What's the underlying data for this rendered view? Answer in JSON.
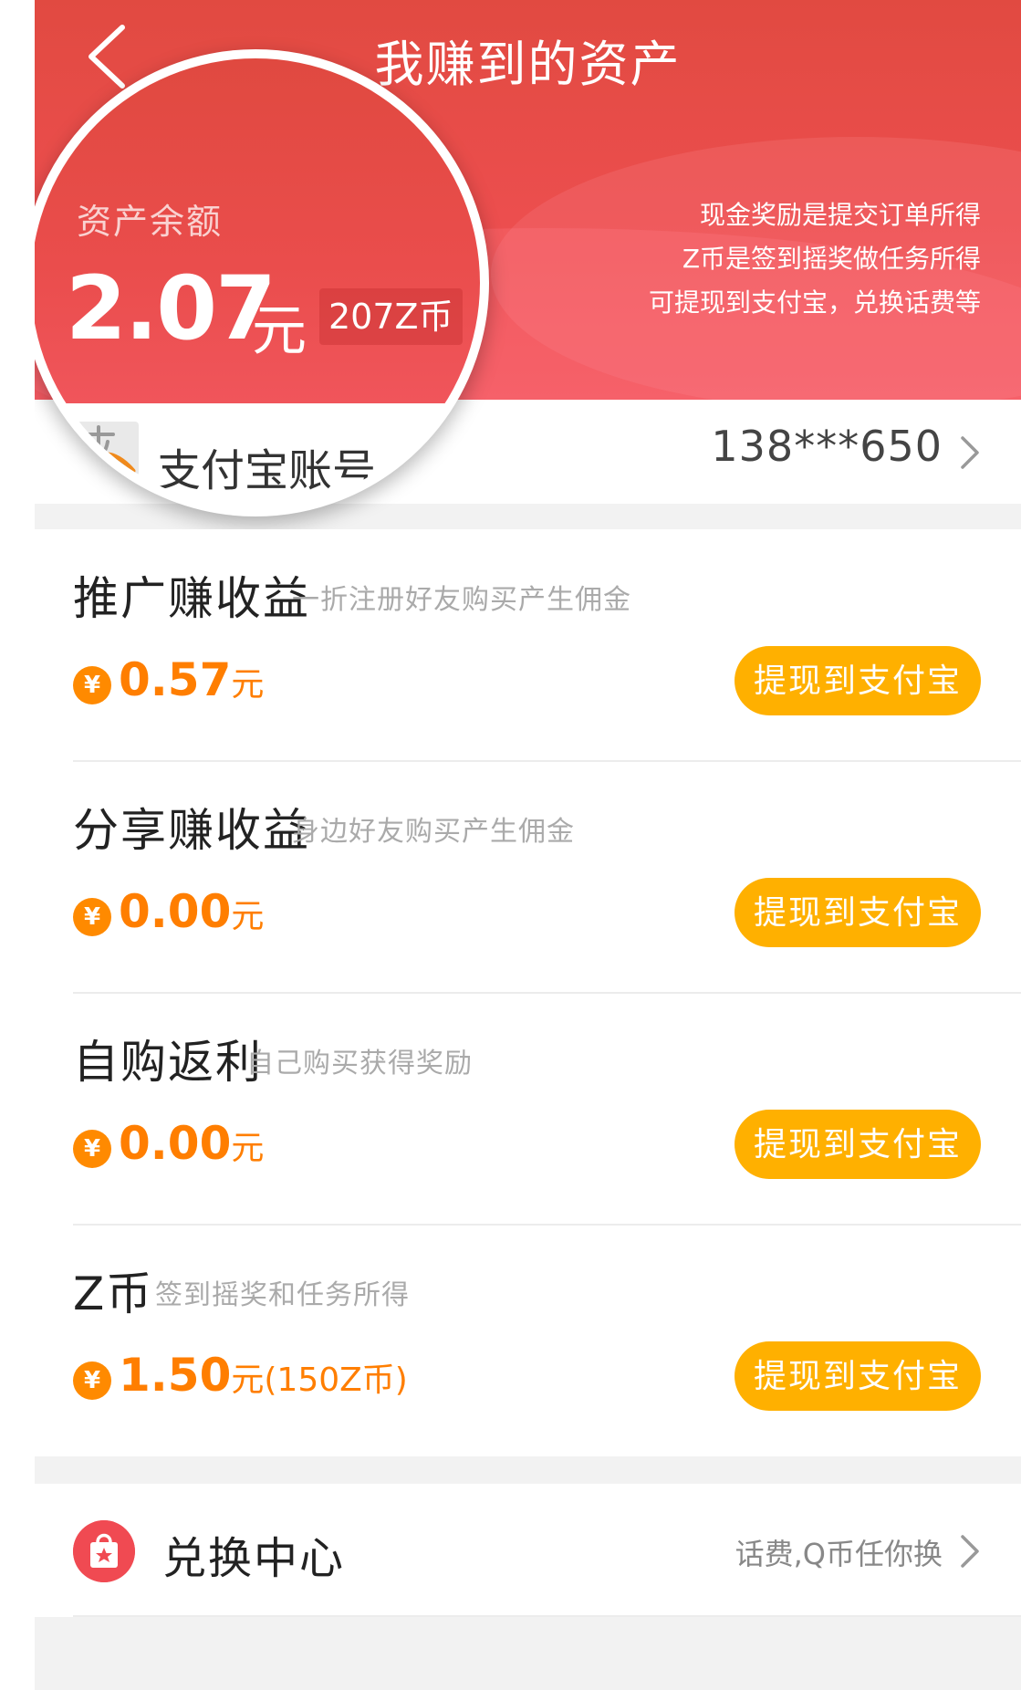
{
  "header": {
    "title": "我赚到的资产",
    "notes": [
      "现金奖励是提交订单所得",
      "Z币是签到摇奖做任务所得",
      "可提现到支付宝，兑换话费等"
    ]
  },
  "balance": {
    "label": "资产余额",
    "amount": "2.07",
    "unit": "元",
    "coins_badge": "207Z币"
  },
  "alipay": {
    "label": "支付宝账号",
    "account": "138***650"
  },
  "sections": [
    {
      "title": "推广赚收益",
      "subtitle": "一折注册好友购买产生佣金",
      "coin_symbol": "¥",
      "amount": "0.57",
      "unit": "元",
      "extra": "",
      "button": "提现到支付宝"
    },
    {
      "title": "分享赚收益",
      "subtitle": "身边好友购买产生佣金",
      "coin_symbol": "¥",
      "amount": "0.00",
      "unit": "元",
      "extra": "",
      "button": "提现到支付宝"
    },
    {
      "title": "自购返利",
      "subtitle": "自己购买获得奖励",
      "coin_symbol": "¥",
      "amount": "0.00",
      "unit": "元",
      "extra": "",
      "button": "提现到支付宝"
    },
    {
      "title": "Z币",
      "subtitle": "签到摇奖和任务所得",
      "coin_symbol": "¥",
      "amount": "1.50",
      "unit": "元",
      "extra": "(150Z币)",
      "button": "提现到支付宝"
    }
  ],
  "exchange": {
    "title": "兑换中心",
    "note": "话费,Q币任你换"
  },
  "colors": {
    "header_red": "#e14a41",
    "amount_orange": "#ff7e00",
    "button_yellow": "#ffb000",
    "exchange_icon_red": "#f04a52"
  },
  "icons": {
    "back": "chevron-left-icon",
    "chevron": "chevron-right-icon",
    "coin": "yuan-coin-icon",
    "alipay": "alipay-icon",
    "exchange": "gift-bag-icon"
  }
}
